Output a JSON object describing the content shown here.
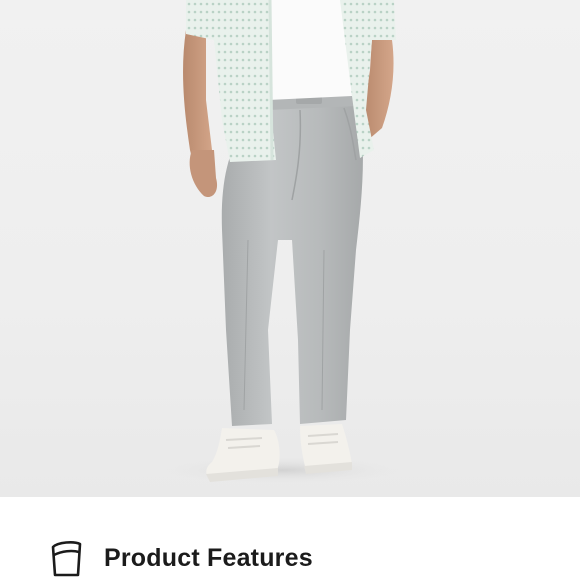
{
  "product_image": {
    "icon": "product-photo"
  },
  "features": {
    "icon": "pants-tag-icon",
    "title": "Product Features"
  }
}
